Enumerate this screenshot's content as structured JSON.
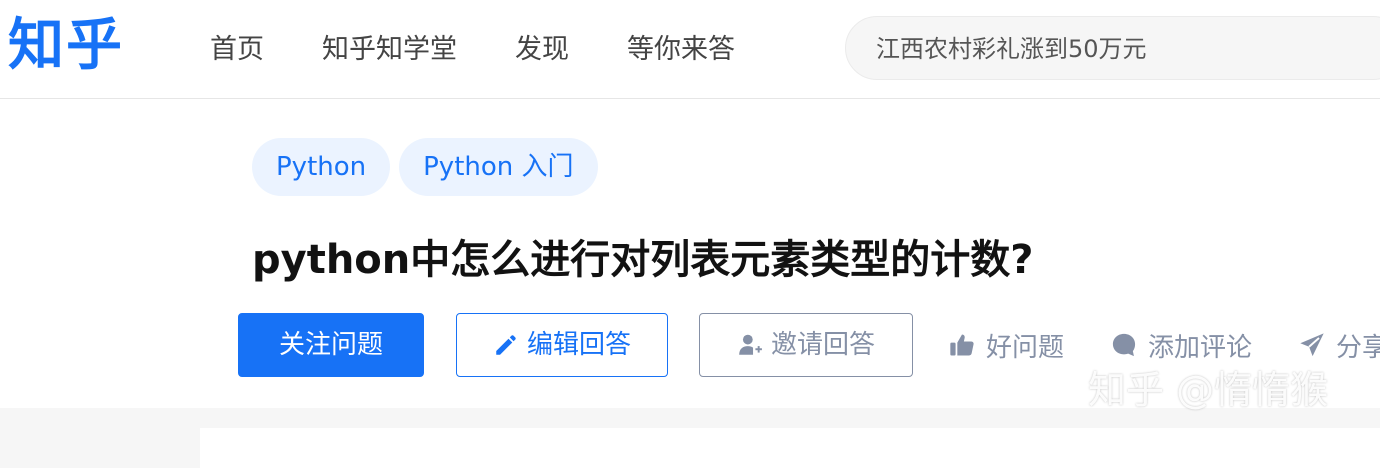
{
  "header": {
    "logo": "知乎",
    "nav": [
      "首页",
      "知乎知学堂",
      "发现",
      "等你来答"
    ],
    "search_placeholder": "江西农村彩礼涨到50万元"
  },
  "question": {
    "tags": [
      "Python",
      "Python 入门"
    ],
    "title": "python中怎么进行对列表元素类型的计数?",
    "actions": {
      "follow": "关注问题",
      "edit": "编辑回答",
      "invite": "邀请回答",
      "good": "好问题",
      "comment": "添加评论",
      "share": "分享"
    }
  },
  "watermark": "知乎 @惰惰猴",
  "colors": {
    "brand": "#1772f6",
    "muted": "#8590a6",
    "tag_bg": "#ebf3ff"
  },
  "icons": [
    "pencil-icon",
    "invite-user-icon",
    "thumbs-up-icon",
    "comment-icon",
    "share-icon"
  ]
}
